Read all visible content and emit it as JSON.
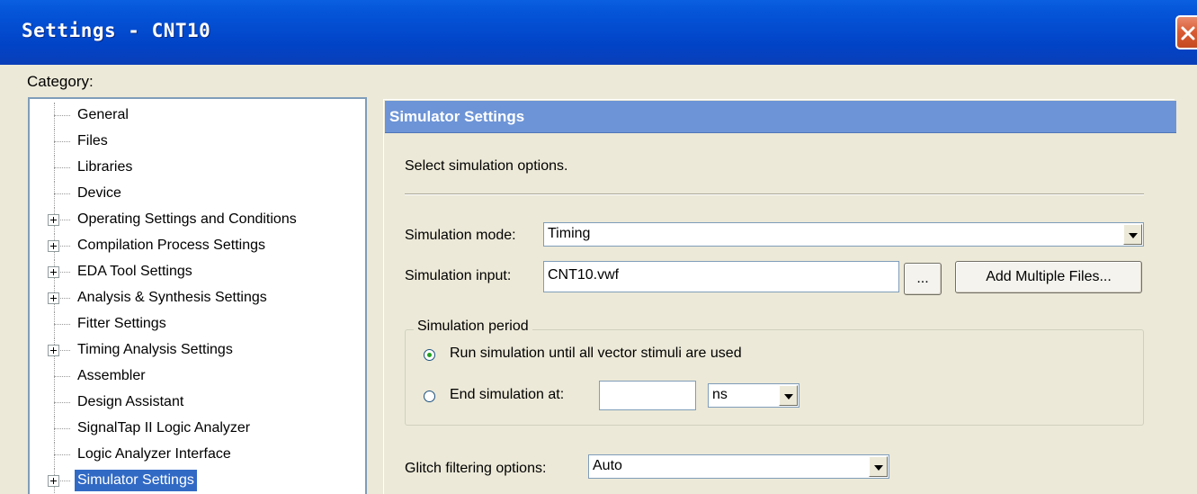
{
  "window": {
    "title": "Settings - CNT10",
    "close_icon": "close-icon"
  },
  "category_label": "Category:",
  "tree": {
    "items": [
      {
        "label": "General",
        "expandable": false,
        "selected": false
      },
      {
        "label": "Files",
        "expandable": false,
        "selected": false
      },
      {
        "label": "Libraries",
        "expandable": false,
        "selected": false
      },
      {
        "label": "Device",
        "expandable": false,
        "selected": false
      },
      {
        "label": "Operating Settings and Conditions",
        "expandable": true,
        "selected": false
      },
      {
        "label": "Compilation Process Settings",
        "expandable": true,
        "selected": false
      },
      {
        "label": "EDA Tool Settings",
        "expandable": true,
        "selected": false
      },
      {
        "label": "Analysis & Synthesis Settings",
        "expandable": true,
        "selected": false
      },
      {
        "label": "Fitter Settings",
        "expandable": false,
        "selected": false
      },
      {
        "label": "Timing Analysis Settings",
        "expandable": true,
        "selected": false
      },
      {
        "label": "Assembler",
        "expandable": false,
        "selected": false
      },
      {
        "label": "Design Assistant",
        "expandable": false,
        "selected": false
      },
      {
        "label": "SignalTap II Logic Analyzer",
        "expandable": false,
        "selected": false
      },
      {
        "label": "Logic Analyzer Interface",
        "expandable": false,
        "selected": false
      },
      {
        "label": "Simulator Settings",
        "expandable": true,
        "selected": true
      }
    ]
  },
  "panel": {
    "header": "Simulator Settings",
    "description": "Select simulation options.",
    "simulation_mode": {
      "label": "Simulation mode:",
      "value": "Timing"
    },
    "simulation_input": {
      "label": "Simulation input:",
      "value": "CNT10.vwf",
      "browse_label": "...",
      "add_files_label": "Add Multiple Files..."
    },
    "simulation_period": {
      "title": "Simulation period",
      "option_run_all": "Run simulation until all vector stimuli are used",
      "option_end_at": "End simulation at:",
      "end_value": "",
      "unit": "ns",
      "selected": "run_all"
    },
    "glitch": {
      "label": "Glitch filtering options:",
      "value": "Auto"
    }
  },
  "colors": {
    "titlebar": "#0143c7",
    "header": "#6d94d6",
    "selection": "#316ac5",
    "dialog_bg": "#ece9d8"
  }
}
